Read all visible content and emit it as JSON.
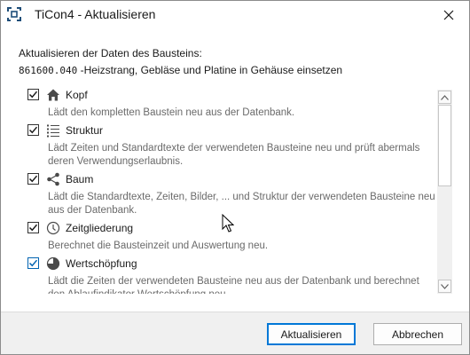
{
  "window": {
    "title": "TiCon4 - Aktualisieren",
    "icon": "app-refresh-icon",
    "close": "close-icon"
  },
  "header": {
    "heading": "Aktualisieren der Daten des Bausteins:",
    "code": "861600.040",
    "description": " -Heizstrang, Gebläse und Platine in Gehäuse einsetzen"
  },
  "options": [
    {
      "title": "Kopf",
      "icon": "home-icon",
      "checked": true,
      "description": "Lädt den kompletten Baustein neu aus der Datenbank."
    },
    {
      "title": "Struktur",
      "icon": "list-icon",
      "checked": true,
      "description": "Lädt Zeiten und Standardtexte der verwendeten Bausteine neu und prüft abermals deren Verwendungserlaubnis."
    },
    {
      "title": "Baum",
      "icon": "share-icon",
      "checked": true,
      "description": "Lädt die Standardtexte, Zeiten, Bilder, ... und Struktur der verwendeten Bausteine neu aus der Datenbank."
    },
    {
      "title": "Zeitgliederung",
      "icon": "clock-icon",
      "checked": true,
      "description": "Berechnet die Bausteinzeit und Auswertung neu."
    },
    {
      "title": "Wertschöpfung",
      "icon": "pie-chart-icon",
      "checked": true,
      "description": "Lädt die Zeiten der verwendeten Bausteine neu aus der Datenbank und berechnet den Ablaufindikator Wertschöpfung neu."
    }
  ],
  "buttons": {
    "primary": "Aktualisieren",
    "cancel": "Abbrechen"
  },
  "colors": {
    "accent": "#0078d7",
    "checkbox_focus": "#0063b1",
    "description_text": "#6a6a6a",
    "footer_bg": "#f0f0f0"
  }
}
